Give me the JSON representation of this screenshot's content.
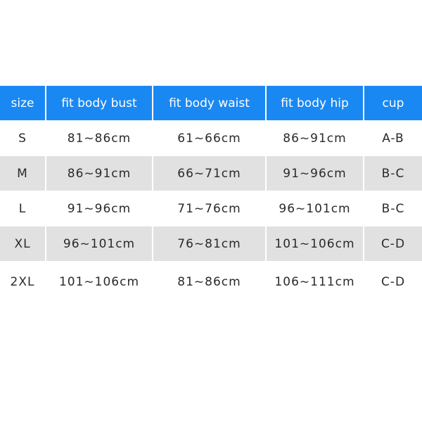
{
  "colors": {
    "header": "#1a88f2",
    "stripe": "#e1e1e1"
  },
  "headers": [
    "size",
    "fit body bust",
    "fit body waist",
    "fit body hip",
    "cup"
  ],
  "rows": [
    [
      "S",
      "81~86cm",
      "61~66cm",
      "86~91cm",
      "A-B"
    ],
    [
      "M",
      "86~91cm",
      "66~71cm",
      "91~96cm",
      "B-C"
    ],
    [
      "L",
      "91~96cm",
      "71~76cm",
      "96~101cm",
      "B-C"
    ],
    [
      "XL",
      "96~101cm",
      "76~81cm",
      "101~106cm",
      "C-D"
    ],
    [
      "2XL",
      "101~106cm",
      "81~86cm",
      "106~111cm",
      "C-D"
    ]
  ]
}
